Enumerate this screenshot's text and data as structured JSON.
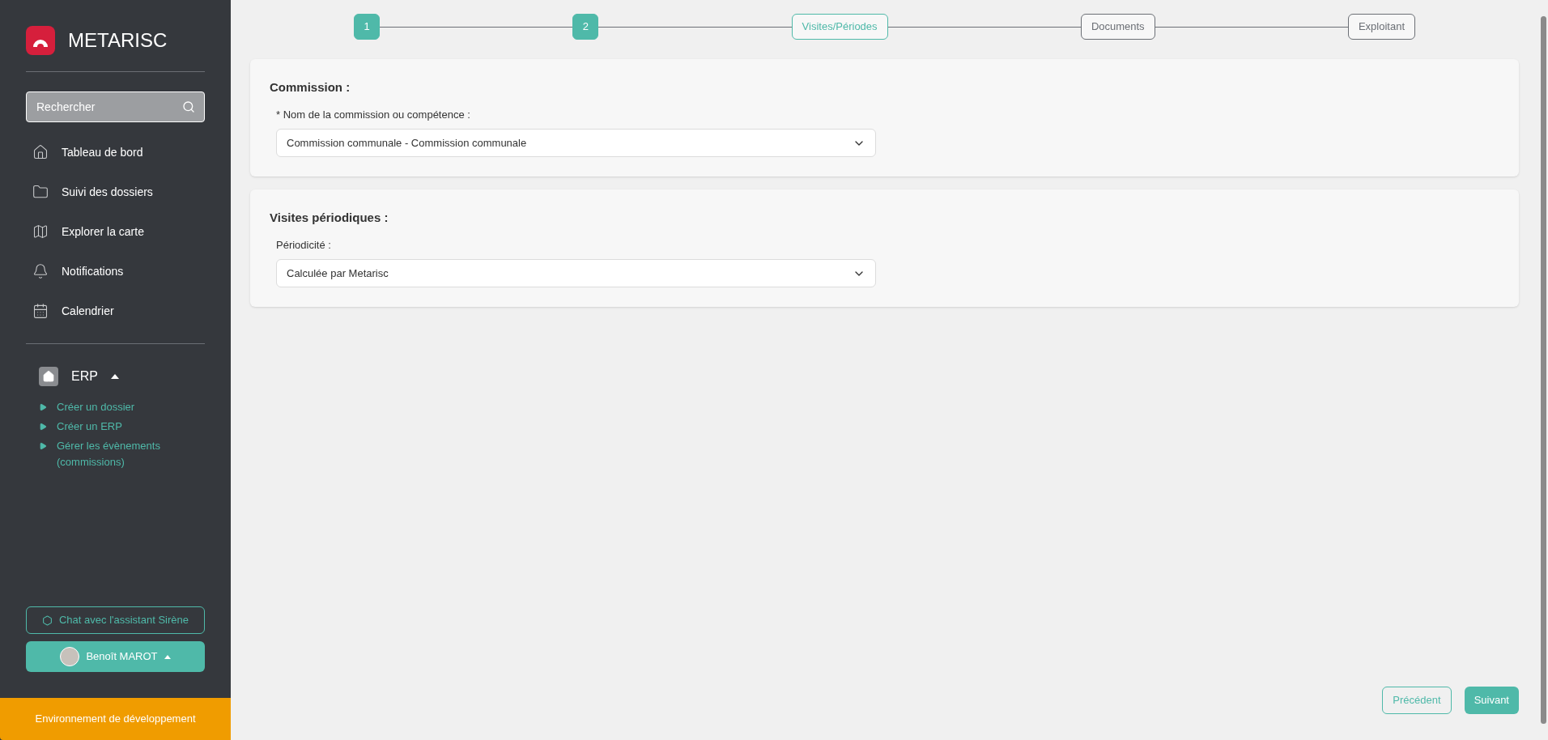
{
  "brand": {
    "name": "METARISC"
  },
  "search": {
    "placeholder": "Rechercher"
  },
  "nav": [
    {
      "kind": "home",
      "label": "Tableau de bord"
    },
    {
      "kind": "folder",
      "label": "Suivi des dossiers"
    },
    {
      "kind": "map",
      "label": "Explorer la carte"
    },
    {
      "kind": "bell",
      "label": "Notifications"
    },
    {
      "kind": "calendar",
      "label": "Calendrier"
    }
  ],
  "section": {
    "label": "ERP",
    "expanded": true,
    "children": [
      {
        "label": "Créer un dossier"
      },
      {
        "label": "Créer un ERP"
      },
      {
        "label": "Gérer les évènements (commissions)"
      }
    ]
  },
  "chat_button": {
    "label": "Chat avec l'assistant Sirène"
  },
  "user": {
    "name": "Benoît MAROT"
  },
  "environment": "Environnement de développement",
  "steps": [
    {
      "label": "1",
      "done": true,
      "selected": false
    },
    {
      "label": "2",
      "done": true,
      "selected": false
    },
    {
      "label": "Visites/Périodes",
      "done": false,
      "selected": true
    },
    {
      "label": "Documents",
      "done": false,
      "selected": false
    },
    {
      "label": "Exploitant",
      "done": false,
      "selected": false
    }
  ],
  "cards": [
    {
      "title": "Commission :",
      "field_label": "* Nom de la commission ou compétence :",
      "value": "Commission communale - Commission communale"
    },
    {
      "title": "Visites périodiques :",
      "field_label": "Périodicité :",
      "value": "Calculée par Metarisc"
    }
  ],
  "footer": {
    "previous": "Précédent",
    "next": "Suivant"
  }
}
